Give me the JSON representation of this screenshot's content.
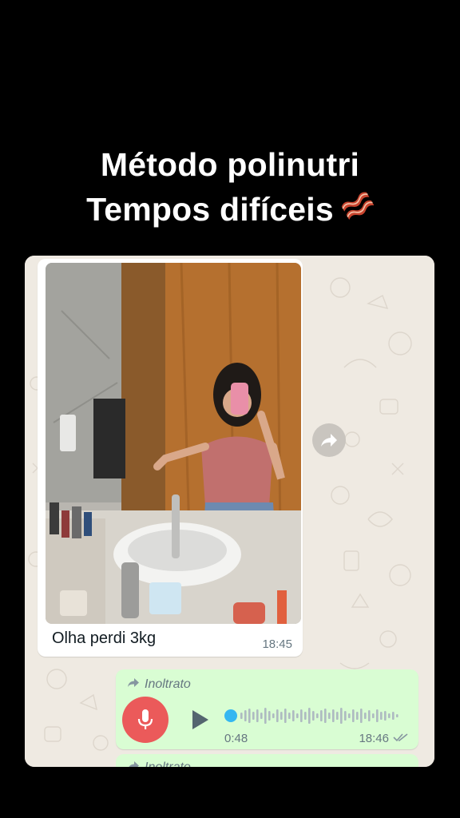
{
  "headline": {
    "line1": "Método polinutri",
    "line2": "Tempos difíceis",
    "emoji_icon": "bacon-icon"
  },
  "chat": {
    "wallpaper_color": "#efeae2",
    "image_message": {
      "caption": "Olha perdi 3kg",
      "time": "18:45",
      "forward_icon": "share-arrow-icon"
    },
    "voice_message": {
      "forwarded_label": "Inoltrato",
      "duration": "0:48",
      "time": "18:46",
      "status_icon": "double-check-icon",
      "bubble_color": "#d9fdd3",
      "mic_color": "#eb5a5a",
      "progress": 0.0
    },
    "next_message": {
      "forwarded_label": "Inoltrato"
    }
  }
}
